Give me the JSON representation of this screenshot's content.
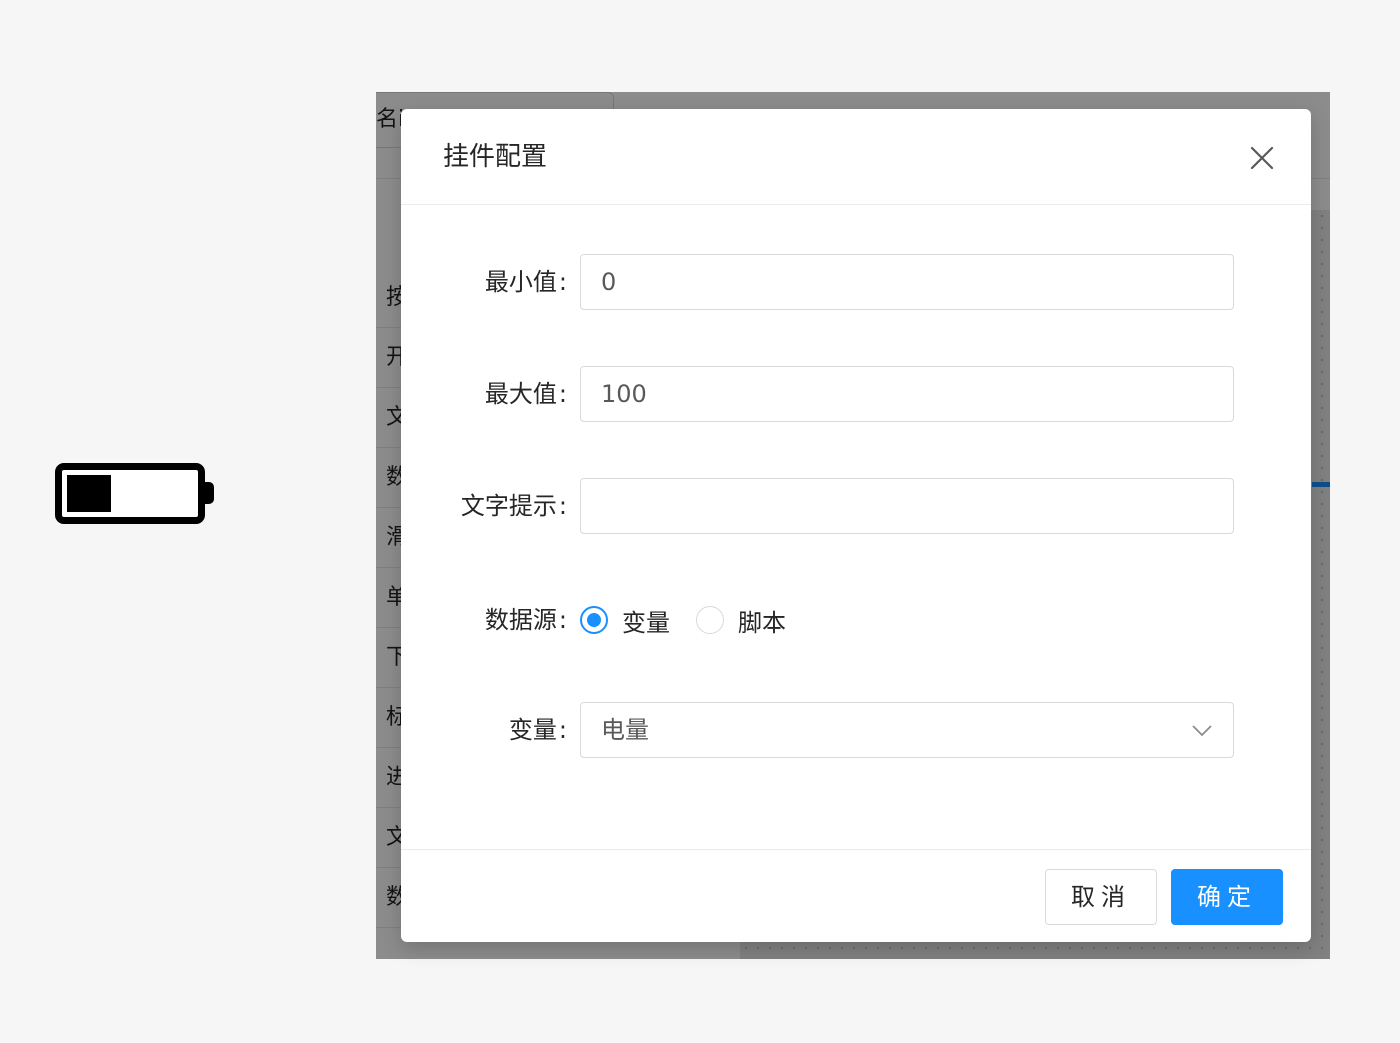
{
  "editor": {
    "name_tab_fragment": "名i",
    "palette_items": [
      "按",
      "开",
      "文",
      "数",
      "滑",
      "单",
      "下",
      "标",
      "进",
      "文",
      "数"
    ]
  },
  "widget_preview": {
    "type": "battery",
    "level": 0.35
  },
  "modal": {
    "title": "挂件配置",
    "fields": {
      "min": {
        "label": "最小值",
        "value": "0"
      },
      "max": {
        "label": "最大值",
        "value": "100"
      },
      "hint": {
        "label": "文字提示",
        "value": ""
      },
      "source": {
        "label": "数据源",
        "options": [
          {
            "label": "变量",
            "checked": true
          },
          {
            "label": "脚本",
            "checked": false
          }
        ]
      },
      "variable": {
        "label": "变量",
        "selected": "电量"
      }
    },
    "footer": {
      "cancel_label": "取消",
      "ok_label": "确定"
    }
  },
  "colors": {
    "primary": "#1890ff",
    "border": "#d9d9d9",
    "mask": "rgba(0,0,0,0.45)"
  },
  "icons": {
    "close": "close-icon",
    "select_arrow": "chevron-down-icon"
  }
}
